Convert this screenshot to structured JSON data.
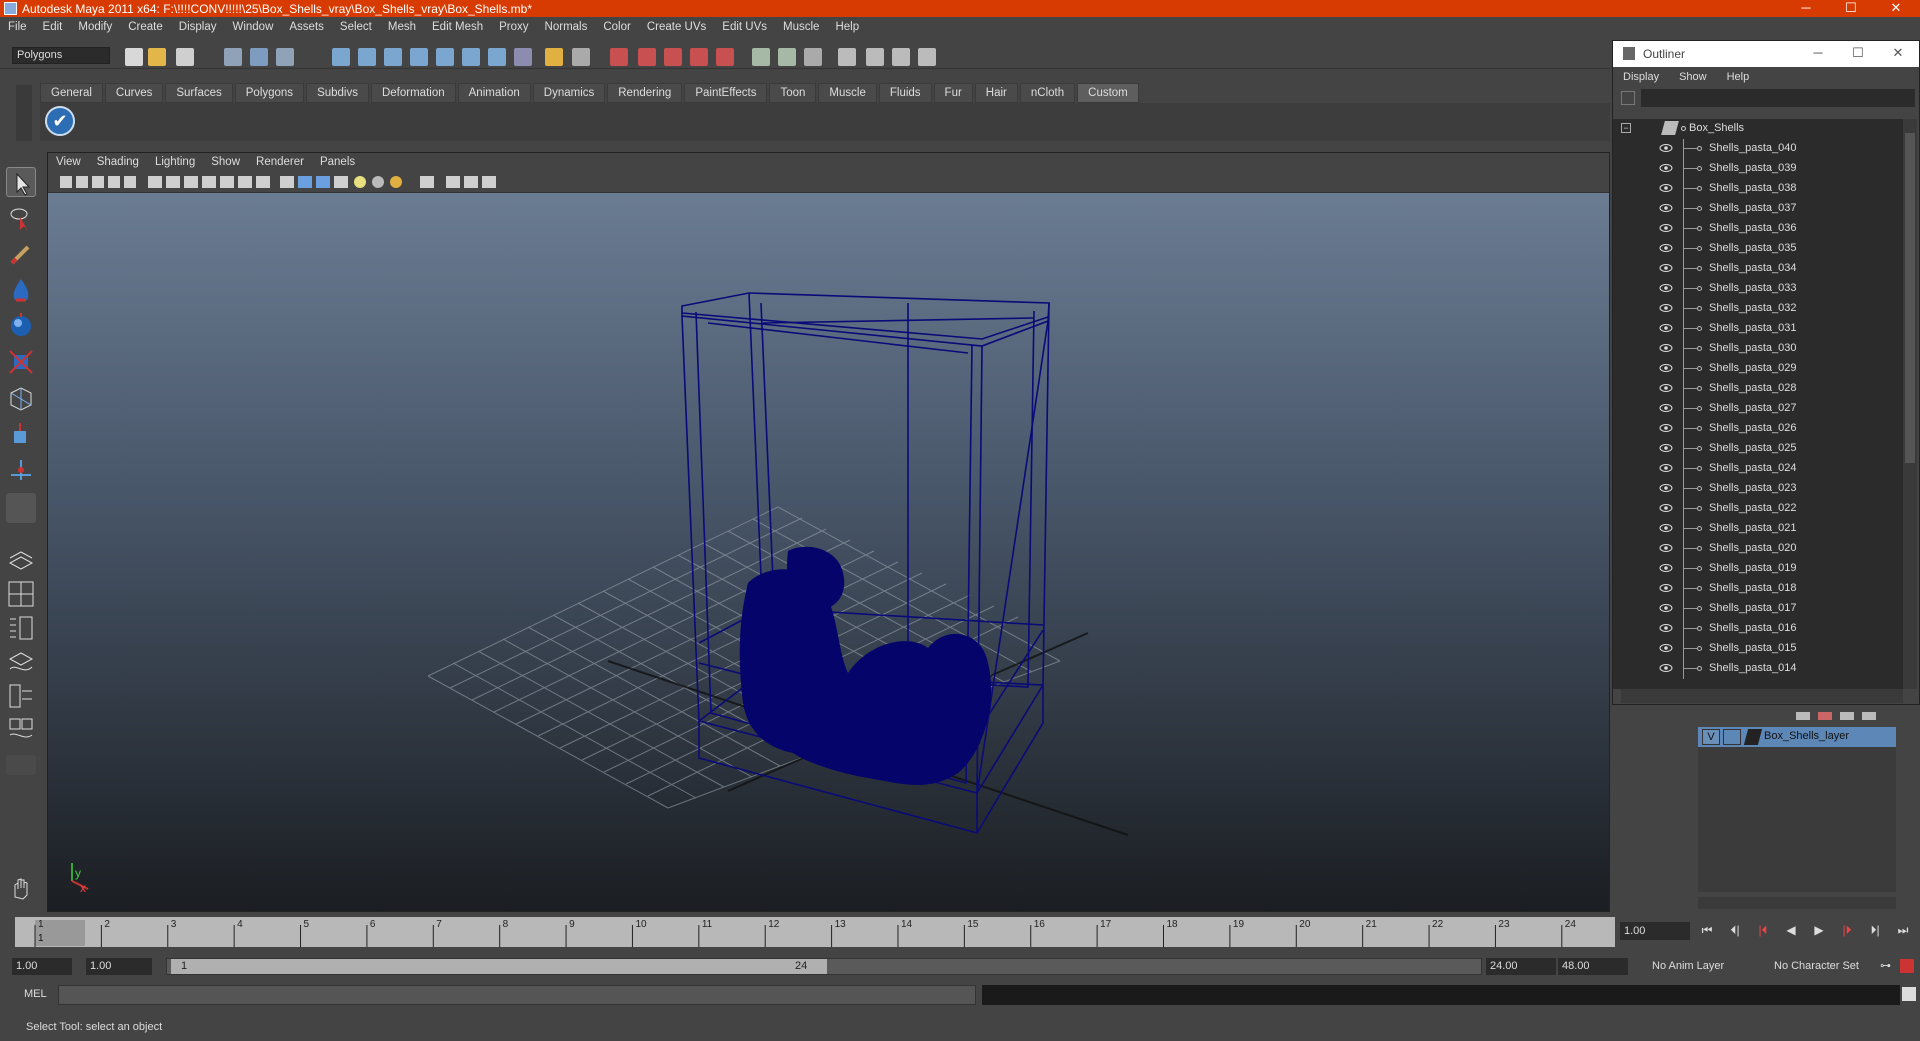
{
  "window": {
    "title": "Autodesk Maya 2011 x64: F:\\!!!!CONV!!!!!\\25\\Box_Shells_vray\\Box_Shells_vray\\Box_Shells.mb*",
    "minimize": "─",
    "maximize": "☐",
    "close": "✕"
  },
  "menubar": [
    "File",
    "Edit",
    "Modify",
    "Create",
    "Display",
    "Window",
    "Assets",
    "Select",
    "Mesh",
    "Edit Mesh",
    "Proxy",
    "Normals",
    "Color",
    "Create UVs",
    "Edit UVs",
    "Muscle",
    "Help"
  ],
  "statusline": {
    "mode": "Polygons"
  },
  "shelf": {
    "tabs": [
      "General",
      "Curves",
      "Surfaces",
      "Polygons",
      "Subdivs",
      "Deformation",
      "Animation",
      "Dynamics",
      "Rendering",
      "PaintEffects",
      "Toon",
      "Muscle",
      "Fluids",
      "Fur",
      "Hair",
      "nCloth",
      "Custom"
    ],
    "active_tab": "Custom",
    "check_icon": "✔"
  },
  "viewport": {
    "menu": [
      "View",
      "Shading",
      "Lighting",
      "Show",
      "Renderer",
      "Panels"
    ],
    "axis_y": "y",
    "axis_x": "x",
    "wire_color": "#0a0a78"
  },
  "timeline": {
    "ticks": [
      "1",
      "2",
      "3",
      "4",
      "5",
      "6",
      "7",
      "8",
      "9",
      "10",
      "11",
      "12",
      "13",
      "14",
      "15",
      "16",
      "17",
      "18",
      "19",
      "20",
      "21",
      "22",
      "23",
      "24"
    ],
    "current_frame_label": "1",
    "current_frame": "1.00",
    "playback_icons": [
      "⏮",
      "⏴|",
      "|⏴",
      "◀",
      "▶",
      "|⏵",
      "⏵|",
      "⏭"
    ]
  },
  "range": {
    "start": "1.00",
    "playback_start": "1.00",
    "slider_start": "1",
    "slider_end": "24",
    "playback_end": "24.00",
    "end": "48.00",
    "anim_layer": "No Anim Layer",
    "character_set": "No Character Set"
  },
  "cmdline": {
    "label": "MEL"
  },
  "helpline": {
    "text": "Select Tool: select an object"
  },
  "outliner": {
    "title": "Outliner",
    "menu": [
      "Display",
      "Show",
      "Help"
    ],
    "root": "Box_Shells",
    "items": [
      "Shells_pasta_040",
      "Shells_pasta_039",
      "Shells_pasta_038",
      "Shells_pasta_037",
      "Shells_pasta_036",
      "Shells_pasta_035",
      "Shells_pasta_034",
      "Shells_pasta_033",
      "Shells_pasta_032",
      "Shells_pasta_031",
      "Shells_pasta_030",
      "Shells_pasta_029",
      "Shells_pasta_028",
      "Shells_pasta_027",
      "Shells_pasta_026",
      "Shells_pasta_025",
      "Shells_pasta_024",
      "Shells_pasta_023",
      "Shells_pasta_022",
      "Shells_pasta_021",
      "Shells_pasta_020",
      "Shells_pasta_019",
      "Shells_pasta_018",
      "Shells_pasta_017",
      "Shells_pasta_016",
      "Shells_pasta_015",
      "Shells_pasta_014"
    ]
  },
  "layers": {
    "visible_flag": "V",
    "name": "Box_Shells_layer"
  }
}
